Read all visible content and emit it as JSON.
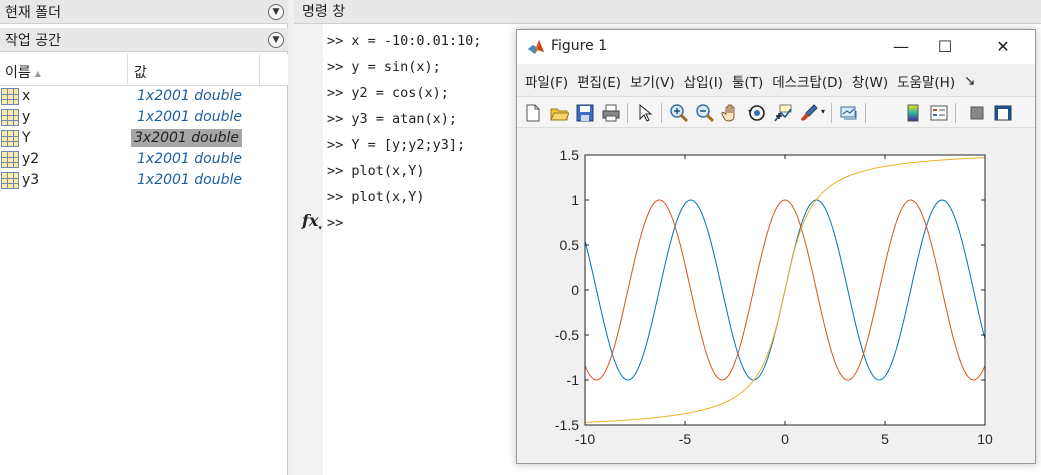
{
  "left": {
    "current_folder_title": "현재 폴더",
    "workspace_title": "작업 공간",
    "columns": {
      "name": "이름",
      "value": "값"
    },
    "variables": [
      {
        "name": "x",
        "value": "1x2001 double",
        "selected": false
      },
      {
        "name": "y",
        "value": "1x2001 double",
        "selected": false
      },
      {
        "name": "Y",
        "value": "3x2001 double",
        "selected": true
      },
      {
        "name": "y2",
        "value": "1x2001 double",
        "selected": false
      },
      {
        "name": "y3",
        "value": "1x2001 double",
        "selected": false
      }
    ]
  },
  "command_window": {
    "title": "명령 창",
    "lines": [
      ">> x = -10:0.01:10;",
      ">> y = sin(x);",
      ">> y2 = cos(x);",
      ">> y3 = atan(x);",
      ">> Y = [y;y2;y3];",
      ">> plot(x,Y)",
      ">> plot(x,Y)",
      ">>"
    ],
    "fx_label": "fx"
  },
  "figure": {
    "title": "Figure 1",
    "window_buttons": {
      "minimize": "—",
      "maximize": "☐",
      "close": "✕"
    },
    "menu": [
      "파일(F)",
      "편집(E)",
      "보기(V)",
      "삽입(I)",
      "툴(T)",
      "데스크탑(D)",
      "창(W)",
      "도움말(H)",
      "↘"
    ],
    "toolbar_icons": [
      "new-figure-icon",
      "open-icon",
      "save-icon",
      "print-icon",
      "pointer-icon",
      "zoom-in-icon",
      "zoom-out-icon",
      "pan-icon",
      "rotate-icon",
      "data-cursor-icon",
      "brush-icon",
      "link-icon",
      "colorbar-icon",
      "legend-icon",
      "hide-plot-tools-icon",
      "show-plot-tools-icon"
    ]
  },
  "chart_data": {
    "type": "line",
    "x_range": [
      -10,
      10
    ],
    "ylim": [
      -1.5,
      1.5
    ],
    "xticks": [
      -10,
      -5,
      0,
      5,
      10
    ],
    "yticks": [
      -1.5,
      -1,
      -0.5,
      0,
      0.5,
      1,
      1.5
    ],
    "step": 0.01,
    "series": [
      {
        "function": "sin",
        "color": "#0072bd"
      },
      {
        "function": "cos",
        "color": "#d95319"
      },
      {
        "function": "atan",
        "color": "#edb120"
      }
    ]
  }
}
